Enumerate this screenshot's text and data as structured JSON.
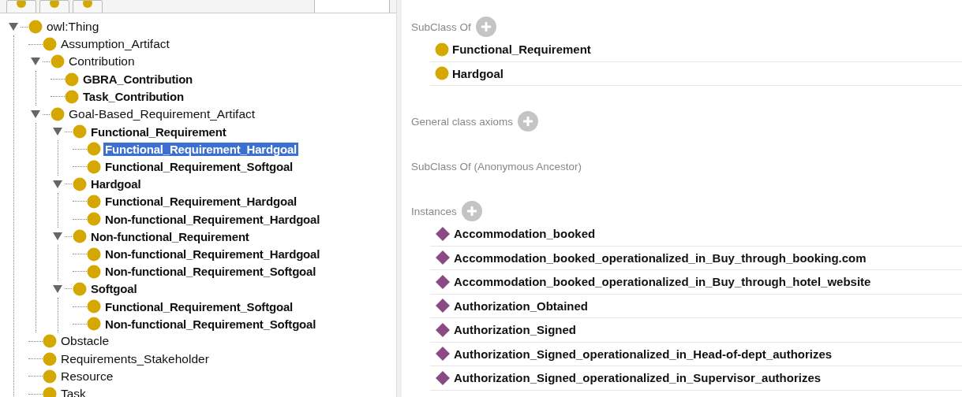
{
  "tree": [
    {
      "label": "owl:Thing",
      "bold": false,
      "selected": false,
      "expanded": true,
      "children": [
        {
          "label": "Assumption_Artifact",
          "bold": false,
          "selected": false
        },
        {
          "label": "Contribution",
          "bold": false,
          "selected": false,
          "expanded": true,
          "children": [
            {
              "label": "GBRA_Contribution",
              "bold": true,
              "selected": false
            },
            {
              "label": "Task_Contribution",
              "bold": true,
              "selected": false
            }
          ]
        },
        {
          "label": "Goal-Based_Requirement_Artifact",
          "bold": false,
          "selected": false,
          "expanded": true,
          "children": [
            {
              "label": "Functional_Requirement",
              "bold": true,
              "selected": false,
              "expanded": true,
              "children": [
                {
                  "label": "Functional_Requirement_Hardgoal",
                  "bold": true,
                  "selected": true
                },
                {
                  "label": "Functional_Requirement_Softgoal",
                  "bold": true,
                  "selected": false
                }
              ]
            },
            {
              "label": "Hardgoal",
              "bold": true,
              "selected": false,
              "expanded": true,
              "children": [
                {
                  "label": "Functional_Requirement_Hardgoal",
                  "bold": true,
                  "selected": false
                },
                {
                  "label": "Non-functional_Requirement_Hardgoal",
                  "bold": true,
                  "selected": false
                }
              ]
            },
            {
              "label": "Non-functional_Requirement",
              "bold": true,
              "selected": false,
              "expanded": true,
              "children": [
                {
                  "label": "Non-functional_Requirement_Hardgoal",
                  "bold": true,
                  "selected": false
                },
                {
                  "label": "Non-functional_Requirement_Softgoal",
                  "bold": true,
                  "selected": false
                }
              ]
            },
            {
              "label": "Softgoal",
              "bold": true,
              "selected": false,
              "expanded": true,
              "children": [
                {
                  "label": "Functional_Requirement_Softgoal",
                  "bold": true,
                  "selected": false
                },
                {
                  "label": "Non-functional_Requirement_Softgoal",
                  "bold": true,
                  "selected": false
                }
              ]
            }
          ]
        },
        {
          "label": "Obstacle",
          "bold": false,
          "selected": false
        },
        {
          "label": "Requirements_Stakeholder",
          "bold": false,
          "selected": false
        },
        {
          "label": "Resource",
          "bold": false,
          "selected": false
        },
        {
          "label": "Task",
          "bold": false,
          "selected": false
        }
      ]
    }
  ],
  "sections": [
    {
      "title": "SubClass Of",
      "addable": true,
      "items": [
        {
          "label": "Functional_Requirement",
          "kind": "class"
        },
        {
          "label": "Hardgoal",
          "kind": "class"
        }
      ]
    },
    {
      "title": "General class axioms",
      "addable": true
    },
    {
      "title": "SubClass Of (Anonymous Ancestor)",
      "addable": false
    },
    {
      "title": "Instances",
      "addable": true,
      "items": [
        {
          "label": "Accommodation_booked",
          "kind": "individual"
        },
        {
          "label": "Accommodation_booked_operationalized_in_Buy_through_booking.com",
          "kind": "individual"
        },
        {
          "label": "Accommodation_booked_operationalized_in_Buy_through_hotel_website",
          "kind": "individual"
        },
        {
          "label": "Authorization_Obtained",
          "kind": "individual"
        },
        {
          "label": "Authorization_Signed",
          "kind": "individual"
        },
        {
          "label": "Authorization_Signed_operationalized_in_Head-of-dept_authorizes",
          "kind": "individual"
        },
        {
          "label": "Authorization_Signed_operationalized_in_Supervisor_authorizes",
          "kind": "individual"
        }
      ]
    }
  ]
}
